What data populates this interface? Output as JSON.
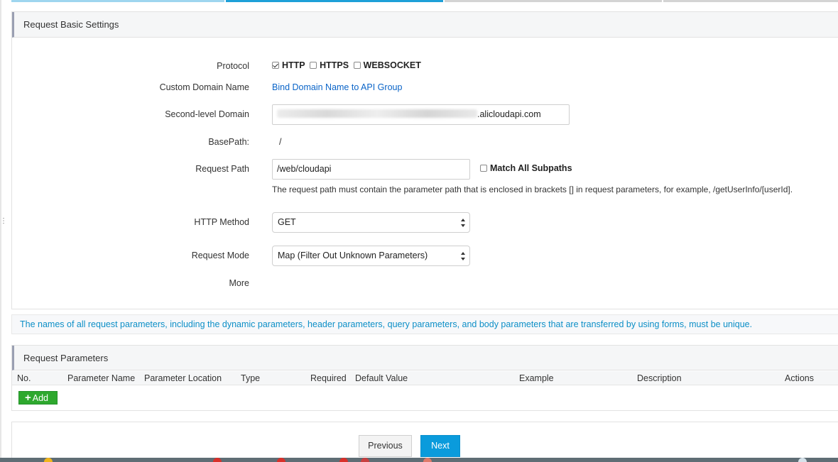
{
  "basic_settings": {
    "title": "Request Basic Settings",
    "protocol": {
      "label": "Protocol",
      "options": [
        {
          "label": "HTTP",
          "checked": true
        },
        {
          "label": "HTTPS",
          "checked": false
        },
        {
          "label": "WEBSOCKET",
          "checked": false
        }
      ]
    },
    "custom_domain": {
      "label": "Custom Domain Name",
      "link": "Bind Domain Name to API Group"
    },
    "second_level_domain": {
      "label": "Second-level Domain",
      "visible_suffix": ".alicloudapi.com"
    },
    "base_path": {
      "label": "BasePath:",
      "value": "/"
    },
    "request_path": {
      "label": "Request Path",
      "value": "/web/cloudapi",
      "match_all_subpaths": {
        "label": "Match All Subpaths",
        "checked": false
      },
      "hint": "The request path must contain the parameter path that is enclosed in brackets [] in request parameters, for example, /getUserInfo/[userId]."
    },
    "http_method": {
      "label": "HTTP Method",
      "value": "GET"
    },
    "request_mode": {
      "label": "Request Mode",
      "value": "Map (Filter Out Unknown Parameters)"
    },
    "more": {
      "label": "More"
    }
  },
  "notice": "The names of all request parameters, including the dynamic parameters, header parameters, query parameters, and body parameters that are transferred by using forms, must be unique.",
  "request_parameters": {
    "title": "Request Parameters",
    "columns": [
      "No.",
      "Parameter Name",
      "Parameter Location",
      "Type",
      "Required",
      "Default Value",
      "Example",
      "Description",
      "Actions"
    ],
    "add_button": "Add"
  },
  "footer": {
    "previous": "Previous",
    "next": "Next"
  },
  "colors": {
    "accent": "#0a9bdc",
    "link": "#0a64c8",
    "add": "#2ea82e",
    "notice_text": "#0d8fc7"
  }
}
